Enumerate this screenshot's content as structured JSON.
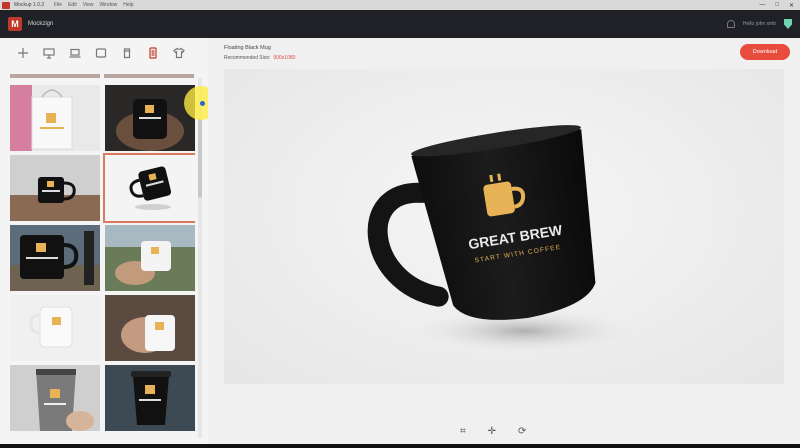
{
  "window": {
    "title": "Mockup 1.0.3",
    "menu": [
      "File",
      "Edit",
      "View",
      "Window",
      "Help"
    ],
    "controls": [
      "—",
      "□",
      "✕"
    ]
  },
  "app": {
    "name": "Mockzign",
    "logo_letter": "M",
    "greeting": "Hello john smb"
  },
  "toolbar": {
    "icons": [
      "plus-icon",
      "desktop-icon",
      "laptop-icon",
      "tablet-icon",
      "cup-icon",
      "phone-icon",
      "tshirt-icon"
    ],
    "active_index": 5
  },
  "mockup": {
    "title": "Floating Black Mug",
    "recommended_label": "Recommended Size:",
    "recommended_size": "900x1080",
    "download_label": "Download"
  },
  "mug": {
    "brand": "GREAT BREW",
    "tagline": "START WITH COFFEE"
  },
  "thumbnails": [
    {
      "name": "shopping-bag",
      "bg": "#e9e9ea"
    },
    {
      "name": "mug-in-hands",
      "bg": "#2a2826"
    },
    {
      "name": "mug-on-table",
      "bg": "#b8a89a"
    },
    {
      "name": "floating-mug",
      "bg": "#f4f4f4",
      "selected": true
    },
    {
      "name": "mug-landscape",
      "bg": "#5d6c7a"
    },
    {
      "name": "mug-in-field",
      "bg": "#7d9070"
    },
    {
      "name": "white-mug",
      "bg": "#f0f0f0"
    },
    {
      "name": "hand-white-mug",
      "bg": "#a98f7c"
    },
    {
      "name": "tumbler",
      "bg": "#cfcfcf"
    },
    {
      "name": "coffee-cup",
      "bg": "#3d4a53"
    }
  ],
  "colors": {
    "accent": "#e74c3c",
    "shield": "#6fd4b0",
    "mug_logo": "#e7b356"
  }
}
